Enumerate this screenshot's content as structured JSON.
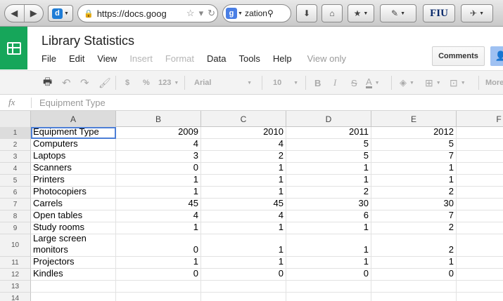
{
  "browser": {
    "url": "https://docs.goog",
    "search_text": "zation",
    "fiu_label": "FIU",
    "nav_back_icon": "back-arrow",
    "nav_forward_icon": "forward-arrow"
  },
  "doc": {
    "title": "Library Statistics",
    "menu": [
      "File",
      "Edit",
      "View",
      "Insert",
      "Format",
      "Data",
      "Tools",
      "Help"
    ],
    "menu_disabled": [
      false,
      false,
      false,
      true,
      true,
      false,
      false,
      false
    ],
    "view_only": "View only",
    "comments_label": "Comments"
  },
  "toolbar": {
    "currency": "$",
    "percent": "%",
    "number_format": "123",
    "font": "Arial",
    "font_size": "10",
    "bold": "B",
    "italic": "I",
    "strike": "S",
    "text_color": "A",
    "more": "More"
  },
  "formula_bar": {
    "fx": "fx",
    "content": "Equipment Type"
  },
  "grid": {
    "columns": [
      "A",
      "B",
      "C",
      "D",
      "E",
      "F"
    ],
    "selected_column": "A",
    "selected_cell": "A1",
    "rows": [
      {
        "n": "1",
        "cells": [
          "Equipment Type",
          "2009",
          "2010",
          "2011",
          "2012"
        ]
      },
      {
        "n": "2",
        "cells": [
          "Computers",
          "4",
          "4",
          "5",
          "5"
        ]
      },
      {
        "n": "3",
        "cells": [
          "Laptops",
          "3",
          "2",
          "5",
          "7"
        ]
      },
      {
        "n": "4",
        "cells": [
          "Scanners",
          "0",
          "1",
          "1",
          "1"
        ]
      },
      {
        "n": "5",
        "cells": [
          "Printers",
          "1",
          "1",
          "1",
          "1"
        ]
      },
      {
        "n": "6",
        "cells": [
          "Photocopiers",
          "1",
          "1",
          "2",
          "2"
        ]
      },
      {
        "n": "7",
        "cells": [
          "Carrels",
          "45",
          "45",
          "30",
          "30"
        ]
      },
      {
        "n": "8",
        "cells": [
          "Open tables",
          "4",
          "4",
          "6",
          "7"
        ]
      },
      {
        "n": "9",
        "cells": [
          "Study rooms",
          "1",
          "1",
          "1",
          "2"
        ]
      },
      {
        "n": "10",
        "cells": [
          "Large screen monitors",
          "0",
          "1",
          "1",
          "2"
        ]
      },
      {
        "n": "11",
        "cells": [
          "Projectors",
          "1",
          "1",
          "1",
          "1"
        ]
      },
      {
        "n": "12",
        "cells": [
          "Kindles",
          "0",
          "0",
          "0",
          "0"
        ]
      },
      {
        "n": "13",
        "cells": [
          "",
          "",
          "",
          "",
          ""
        ]
      },
      {
        "n": "14",
        "cells": [
          "",
          "",
          "",
          "",
          ""
        ]
      }
    ]
  },
  "colors": {
    "docs_green": "#16a65a",
    "selection_blue": "#4d7fd6",
    "share_blue": "#9fc1f2"
  }
}
